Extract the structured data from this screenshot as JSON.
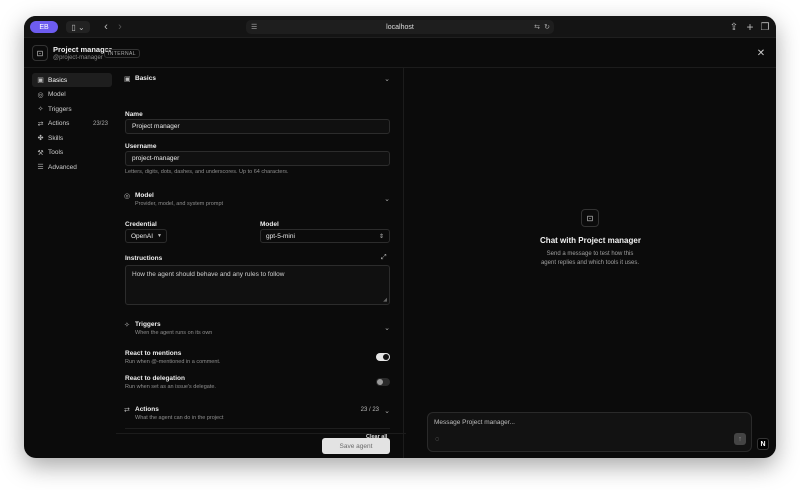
{
  "browser": {
    "address": "localhost",
    "profile_label": "EB"
  },
  "header": {
    "agent_name": "Project manager",
    "agent_handle": "@project-manager",
    "badge": "INTERNAL"
  },
  "nav": {
    "items": [
      {
        "label": "Basics",
        "icon": "id-card-icon",
        "active": true
      },
      {
        "label": "Model",
        "icon": "cpu-icon"
      },
      {
        "label": "Triggers",
        "icon": "sparkle-icon"
      },
      {
        "label": "Actions",
        "icon": "sliders-icon",
        "count": "23/23"
      },
      {
        "label": "Skills",
        "icon": "puzzle-icon"
      },
      {
        "label": "Tools",
        "icon": "wrench-icon"
      },
      {
        "label": "Advanced",
        "icon": "list-icon"
      }
    ]
  },
  "form": {
    "basics": {
      "title": "Basics",
      "name_label": "Name",
      "name_value": "Project manager",
      "username_label": "Username",
      "username_value": "project-manager",
      "username_help": "Letters, digits, dots, dashes, and underscores. Up to 64 characters."
    },
    "model": {
      "title": "Model",
      "subtitle": "Provider, model, and system prompt",
      "credential_label": "Credential",
      "credential_value": "OpenAI",
      "model_label": "Model",
      "model_value": "gpt-5-mini",
      "instructions_label": "Instructions",
      "instructions_placeholder": "How the agent should behave and any rules to follow"
    },
    "triggers": {
      "title": "Triggers",
      "subtitle": "When the agent runs on its own",
      "mentions_title": "React to mentions",
      "mentions_sub": "Run when @-mentioned in a comment.",
      "mentions_on": true,
      "delegation_title": "React to delegation",
      "delegation_sub": "Run when set as an issue's delegate.",
      "delegation_on": false
    },
    "actions": {
      "title": "Actions",
      "subtitle": "What the agent can do in the project",
      "count": "23 / 23",
      "clear_all": "Clear all"
    },
    "save_label": "Save agent"
  },
  "chat": {
    "title": "Chat with Project manager",
    "subtitle": "Send a message to test how this agent replies and which tools it uses.",
    "placeholder": "Message Project manager..."
  },
  "colors": {
    "background": "#0b0b0b",
    "accent_profile": "#6d5cf0"
  }
}
